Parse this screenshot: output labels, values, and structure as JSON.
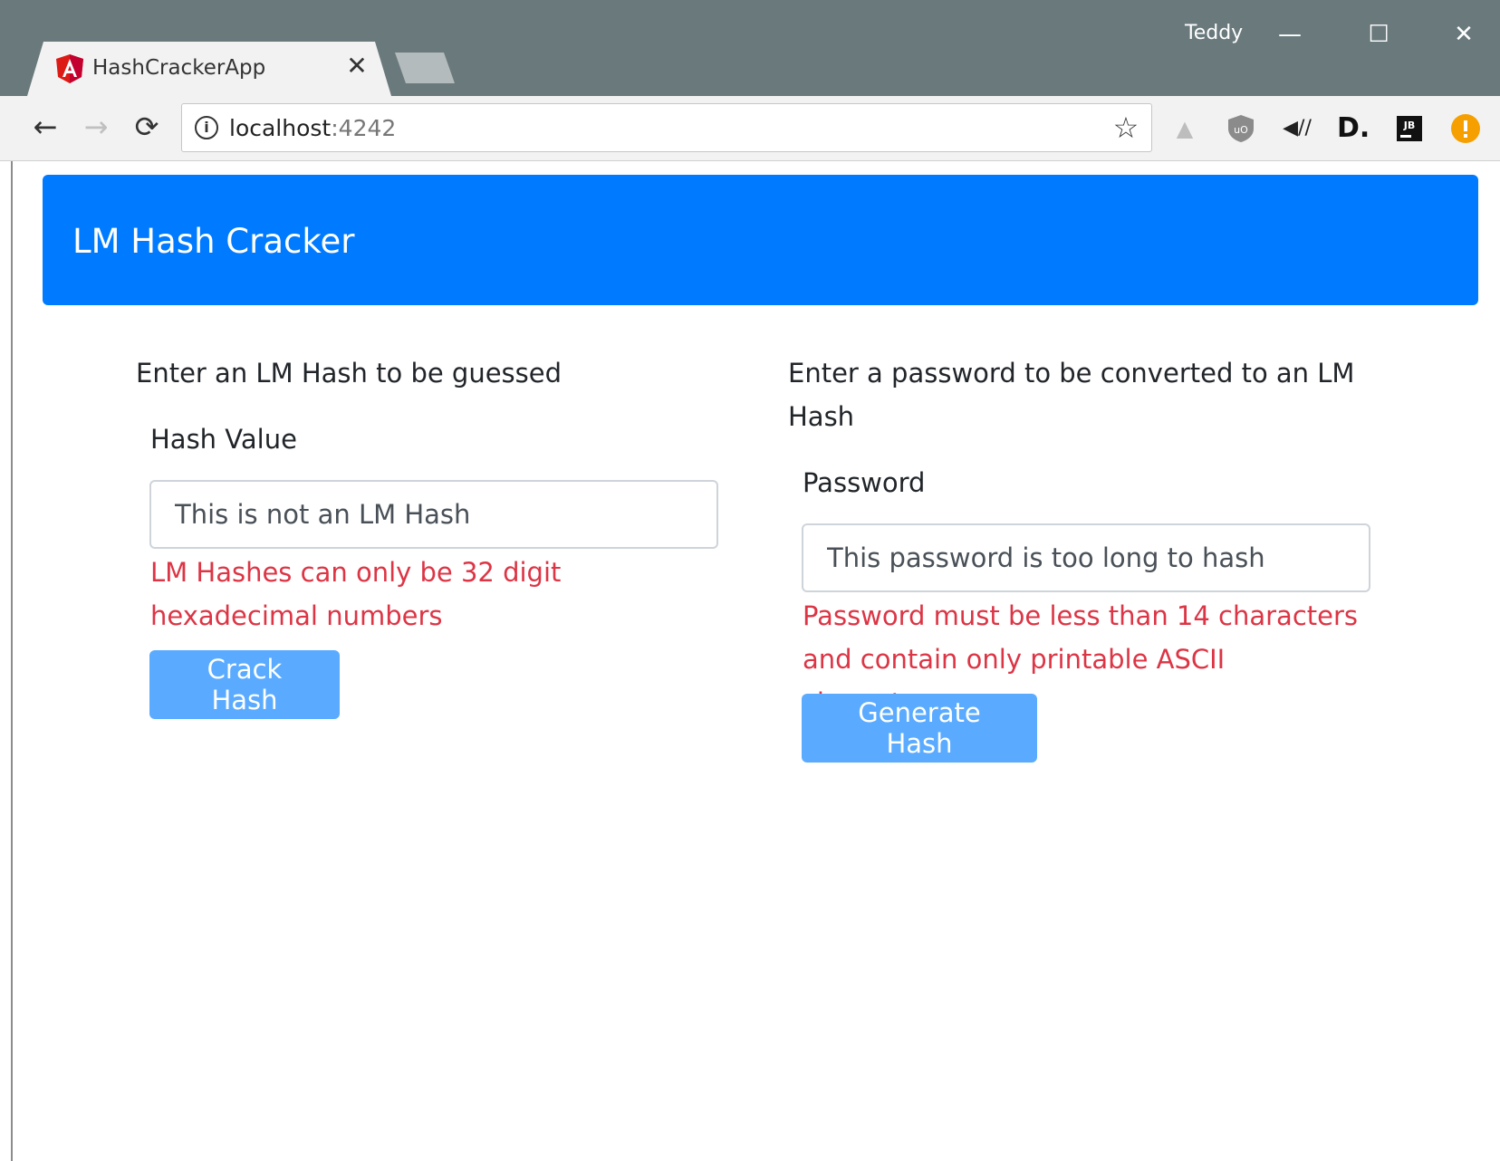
{
  "browser": {
    "tab_title": "HashCrackerApp",
    "tab_close_icon": "close-icon",
    "profile_name": "Teddy",
    "url_host": "localhost",
    "url_port": ":4242",
    "extensions": [
      "google-drive-icon",
      "ublock-icon",
      "audio-icon",
      "dashlane-icon",
      "jetbrains-icon",
      "warning-icon"
    ]
  },
  "app": {
    "brand": "LM Hash Cracker",
    "crack": {
      "intro": "Enter an LM Hash to be guessed",
      "label": "Hash Value",
      "value": "This is not an LM Hash",
      "error": "LM Hashes can only be 32 digit hexadecimal numbers",
      "button": "Crack Hash"
    },
    "generate": {
      "intro": "Enter a password to be converted to an LM Hash",
      "label": "Password",
      "value": "This password is too long to hash",
      "error": "Password must be less than 14 characters and contain only printable ASCII characters",
      "button": "Generate Hash"
    }
  },
  "colors": {
    "navbar": "#007bff",
    "error": "#dc3545",
    "button_disabled": "#5aabff"
  }
}
